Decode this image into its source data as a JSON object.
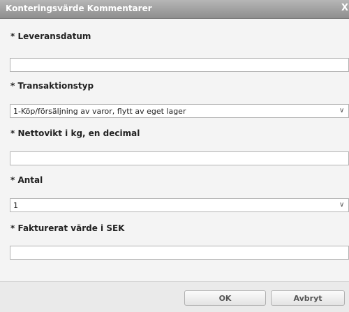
{
  "dialog": {
    "title": "Konteringsvärde Kommentarer",
    "close_label": "X"
  },
  "fields": [
    {
      "label": "* Leveransdatum",
      "type": "text",
      "value": ""
    },
    {
      "label": "* Transaktionstyp",
      "type": "select",
      "value": "1-Köp/försäljning av varor, flytt av eget lager"
    },
    {
      "label": "* Nettovikt i kg, en decimal",
      "type": "text",
      "value": ""
    },
    {
      "label": "* Antal",
      "type": "select",
      "value": "1"
    },
    {
      "label": "* Fakturerat värde i SEK",
      "type": "text",
      "value": ""
    }
  ],
  "buttons": {
    "ok": "OK",
    "cancel": "Avbryt"
  },
  "icons": {
    "dropdown": "chevron-down-icon",
    "close": "close-icon"
  },
  "colors": {
    "titlebar": "#9e9e9e",
    "background": "#f4f4f4",
    "input_border": "#b3b3b3"
  }
}
